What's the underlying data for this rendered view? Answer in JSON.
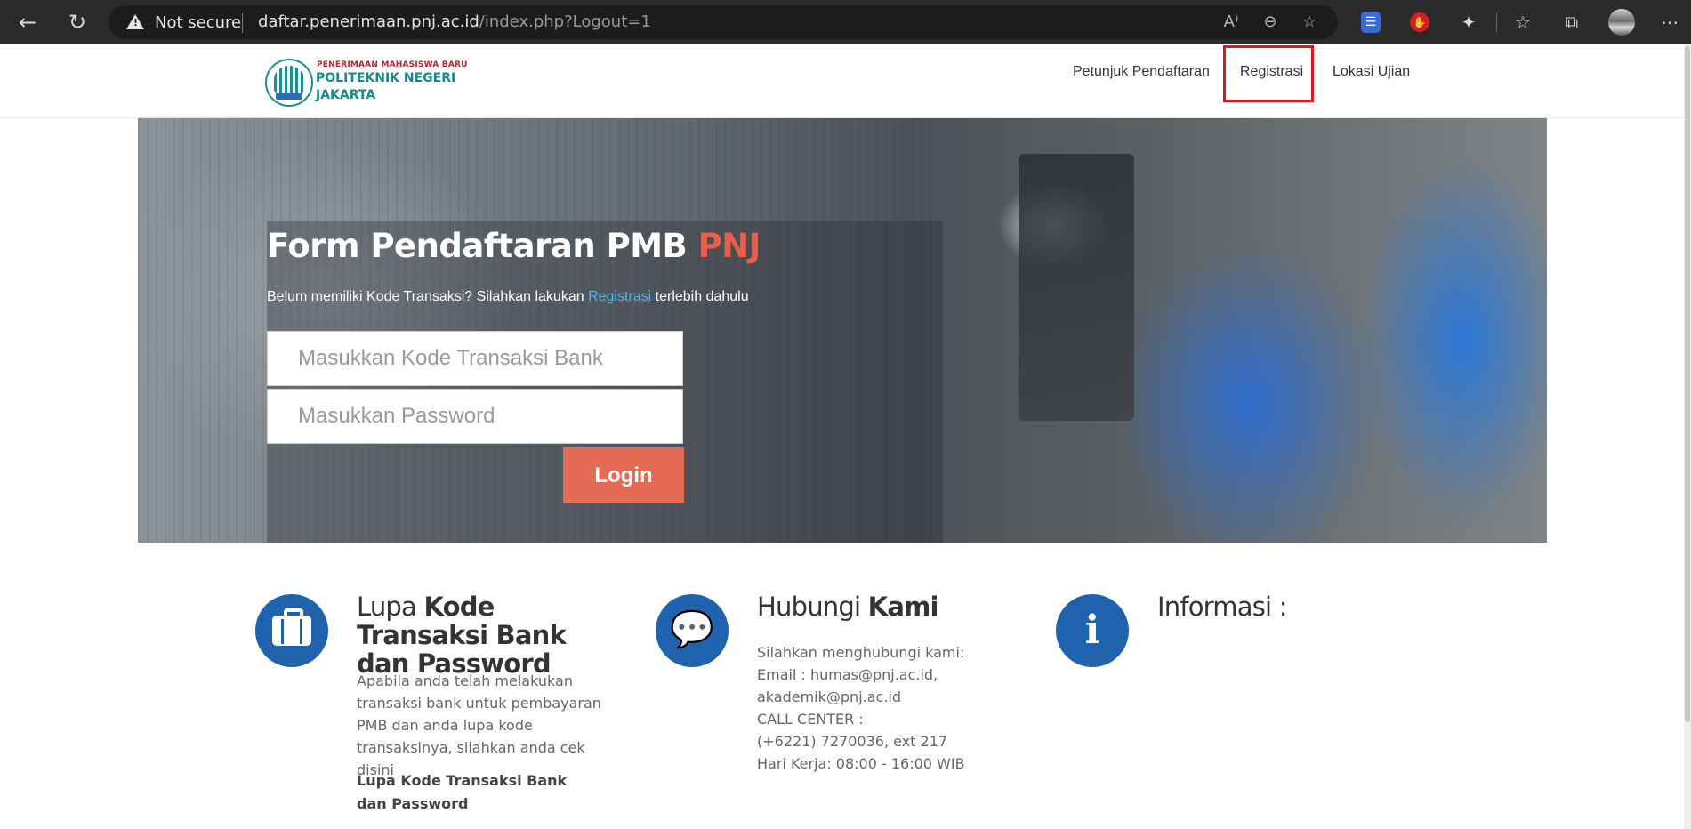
{
  "browser": {
    "security_label": "Not secure",
    "url_host": "daftar.penerimaan.pnj.ac.id",
    "url_path": "/index.php?Logout=1",
    "icons": [
      "back-icon",
      "reload-icon",
      "read-aloud-icon",
      "zoom-out-icon",
      "add-favorite-icon",
      "shield-extension-icon",
      "stop-extension-icon",
      "extensions-icon",
      "favorites-icon",
      "collections-icon",
      "profile-avatar",
      "more-icon"
    ]
  },
  "header": {
    "logo_small": "PENERIMAAN MAHASISWA BARU",
    "logo_line1": "POLITEKNIK NEGERI",
    "logo_line2": "JAKARTA",
    "nav": [
      {
        "label": "Petunjuk Pendaftaran"
      },
      {
        "label": "Registrasi"
      },
      {
        "label": "Lokasi Ujian"
      }
    ],
    "highlight_color": "#e0161c"
  },
  "hero": {
    "title_main": "Form Pendaftaran PMB ",
    "title_accent": "PNJ",
    "subtitle_before": "Belum memiliki Kode Transaksi? Silahkan lakukan ",
    "subtitle_link": "Registrasi",
    "subtitle_after": " terlebih dahulu",
    "code_placeholder": "Masukkan Kode Transaksi Bank",
    "password_placeholder": "Masukkan Password",
    "login_label": "Login",
    "accent_color": "#e8604c"
  },
  "columns": {
    "forgot": {
      "title_light": "Lupa ",
      "title_bold": "Kode Transaksi Bank dan Password",
      "text": "Apabila anda telah melakukan transaksi bank untuk pembayaran PMB dan anda lupa kode transaksinya, silahkan anda cek disini",
      "link": "Lupa Kode Transaksi Bank dan Password"
    },
    "contact": {
      "title_light": "Hubungi ",
      "title_bold": "Kami",
      "lines": [
        "Silahkan menghubungi kami:",
        "Email : humas@pnj.ac.id,",
        "akademik@pnj.ac.id",
        "CALL CENTER :",
        "(+6221) 7270036, ext 217",
        "Hari Kerja: 08:00 - 16:00 WIB"
      ]
    },
    "info": {
      "title": "Informasi :"
    },
    "icon_color": "#1f62ad"
  }
}
